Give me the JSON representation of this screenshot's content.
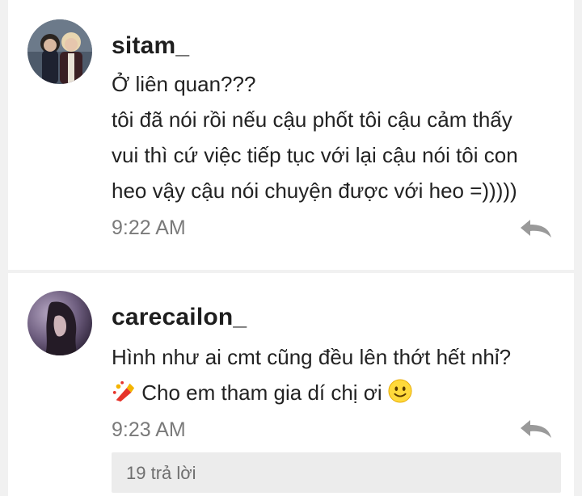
{
  "comments": [
    {
      "username": "sitam_",
      "lines": [
        "Ở liên quan???",
        "tôi đã nói rồi nếu cậu phốt tôi cậu cảm thấy",
        "vui thì cứ việc tiếp tục với lại cậu nói tôi con",
        "heo vậy cậu nói chuyện được với heo =)))))"
      ],
      "time": "9:22 AM",
      "reply_icon": "reply-arrow-icon"
    },
    {
      "username": "carecailon_",
      "lines": [
        "Hình như ai cmt cũng đều lên thớt hết nhỉ?",
        "Cho em tham gia dí chị ơi"
      ],
      "leading_emoji": "nail-polish-emoji",
      "trailing_emoji": "slightly-smiling-face-emoji",
      "time": "9:23 AM",
      "reply_icon": "reply-arrow-icon",
      "replies_label": "19 trả lời"
    }
  ],
  "colors": {
    "background": "#f1f1f1",
    "card": "#ffffff",
    "username": "#1e1e1e",
    "timestamp": "#7a7a7a",
    "reply_icon": "#9a9a9a",
    "replies_bar": "#ececec"
  }
}
